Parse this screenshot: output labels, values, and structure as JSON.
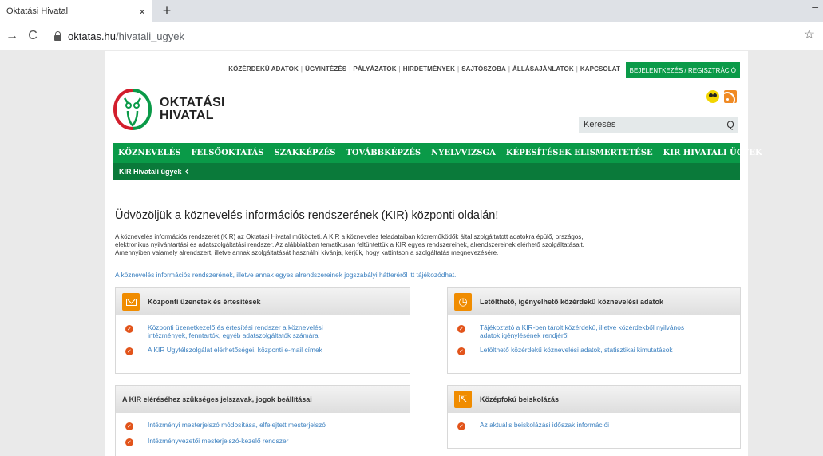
{
  "browser": {
    "tab_title": "Oktatási Hivatal",
    "tab_close": "×",
    "new_tab": "+",
    "minimize": "–",
    "back": "→",
    "reload": "C",
    "url_host": "oktatas.hu",
    "url_path": "/hivatali_ugyek",
    "bookmark": "☆"
  },
  "header": {
    "top_links": [
      "KÖZÉRDEKŰ ADATOK",
      "ÜGYINTÉZÉS",
      "PÁLYÁZATOK",
      "HIRDETMÉNYEK",
      "SAJTÓSZOBA",
      "ÁLLÁSAJÁNLATOK",
      "KAPCSOLAT"
    ],
    "login_label": "BEJELENTKEZÉS / REGISZTRÁCIÓ",
    "logo_line1": "OKTATÁSI",
    "logo_line2": "HIVATAL",
    "search_placeholder": "Keresés",
    "search_glyph": "Q"
  },
  "main_nav": [
    "KÖZNEVELÉS",
    "FELSŐOKTATÁS",
    "SZAKKÉPZÉS",
    "TOVÁBBKÉPZÉS",
    "NYELVVIZSGA",
    "KÉPESÍTÉSEK ELISMERTETÉSE",
    "KIR HIVATALI ÜGYEK"
  ],
  "sub_nav": {
    "label": "KIR Hivatali ügyek",
    "chevron": "‹"
  },
  "content": {
    "heading": "Üdvözöljük a köznevelés információs rendszerének (KIR) központi oldalán!",
    "intro_1": "A köznevelés információs rendszerét (KIR) az Oktatási Hivatal működteti. A KIR a köznevelés feladataiban közreműködők által szolgáltatott adatokra épülő, országos,",
    "intro_2": "elektronikus nyilvántartási és adatszolgáltatási rendszer. Az alábbiakban tematikusan feltüntettük a KIR egyes rendszereinek, alrendszereinek elérhető szolgáltatásait.",
    "intro_3": "Amennyiben valamely alrendszert, illetve annak szolgáltatását használni kívánja, kérjük, hogy kattintson a szolgáltatás megnevezésére.",
    "intro_link": "A köznevelés információs rendszerének, illetve annak egyes alrendszereinek jogszabályi hátteréről itt tájékozódhat."
  },
  "boxes": {
    "central": {
      "title": "Központi üzenetek és értesítések",
      "items": [
        {
          "line1": "Központi üzenetkezelő és értesítési rendszer a köznevelési",
          "line2": "intézmények, fenntartók, egyéb adatszolgáltatók számára"
        },
        {
          "line1": "A KIR Ügyfélszolgálat elérhetőségei, központi e-mail címek",
          "line2": ""
        }
      ]
    },
    "downloads": {
      "title": "Letölthető, igényelhető közérdekű köznevelési adatok",
      "items": [
        {
          "line1": "Tájékoztató a KIR-ben tárolt közérdekű, illetve közérdekből nyilvános",
          "line2": "adatok igénylésének rendjéről"
        },
        {
          "line1": "Letölthető közérdekű köznevelési adatok, statisztikai kimutatások",
          "line2": ""
        }
      ]
    },
    "passwords": {
      "title": "A KIR eléréséhez szükséges jelszavak, jogok beállításai",
      "items": [
        {
          "line1": "Intézményi mesterjelszó módosítása, elfelejtett mesterjelszó"
        },
        {
          "line1": "Intézményvezetői mesterjelszó-kezelő rendszer"
        }
      ]
    },
    "secondary": {
      "title": "Középfokú beiskolázás",
      "items": [
        {
          "line1": "Az aktuális beiskolázási időszak információi"
        }
      ]
    }
  },
  "colors": {
    "green": "#0a9a48",
    "dark_green": "#0a7a3a",
    "orange": "#f08c00",
    "link": "#3a7fbf"
  },
  "icons": [
    "envelope-icon",
    "download-clock-icon",
    "school-arrows-icon",
    "check-icon",
    "rss-icon",
    "accessibility-icon"
  ]
}
